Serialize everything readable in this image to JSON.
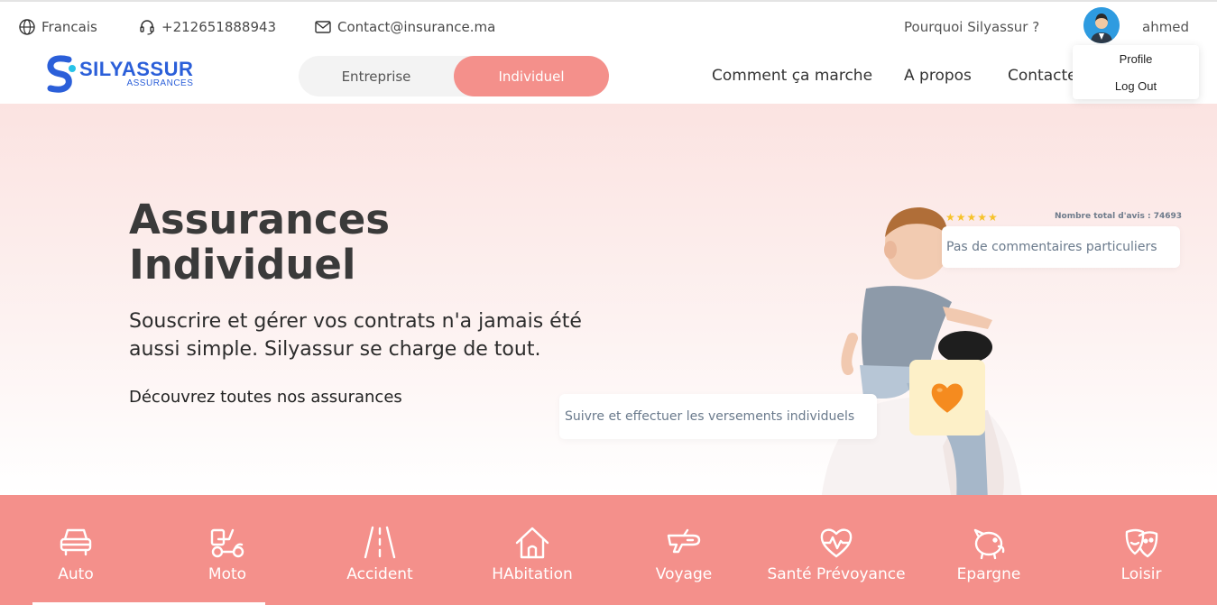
{
  "topbar": {
    "language": "Francais",
    "phone": "+212651888943",
    "email": "Contact@insurance.ma",
    "why_link": "Pourquoi Silyassur ?",
    "user_name": "ahmed"
  },
  "logo": {
    "name": "SILYASSUR",
    "sub": "ASSURANCES"
  },
  "segment": {
    "options": [
      "Entreprise",
      "Individuel"
    ],
    "selected": "Individuel"
  },
  "nav": {
    "links": [
      "Comment ça marche",
      "A propos",
      "Contactez"
    ]
  },
  "user_menu": {
    "items": [
      "Profile",
      "Log Out"
    ]
  },
  "hero": {
    "title_line1": "Assurances",
    "title_line2": "Individuel",
    "subtitle": "Souscrire et gérer vos contrats n'a jamais été aussi simple. Silyassur se charge de tout.",
    "cta": "Découvrez toutes nos assurances",
    "track_card": "Suivre et effectuer les versements individuels",
    "rating": {
      "stars": 5,
      "total_label": "Nombre total d'avis : 74693",
      "comment": "Pas de commentaires particuliers"
    },
    "heart_emoji": "🧡"
  },
  "categories": {
    "items": [
      {
        "label": "Auto",
        "icon": "car-icon"
      },
      {
        "label": "Moto",
        "icon": "scooter-icon"
      },
      {
        "label": "Accident",
        "icon": "road-icon"
      },
      {
        "label": "HAbitation",
        "icon": "house-icon"
      },
      {
        "label": "Voyage",
        "icon": "plane-icon"
      },
      {
        "label": "Santé Prévoyance",
        "icon": "heart-pulse-icon"
      },
      {
        "label": "Epargne",
        "icon": "piggy-bank-icon"
      },
      {
        "label": "Loisir",
        "icon": "masks-icon"
      }
    ],
    "active": "Auto"
  },
  "colors": {
    "accent": "#f4908b",
    "brand_blue": "#2b5fd9",
    "hero_bg": "#fbe3e1"
  }
}
